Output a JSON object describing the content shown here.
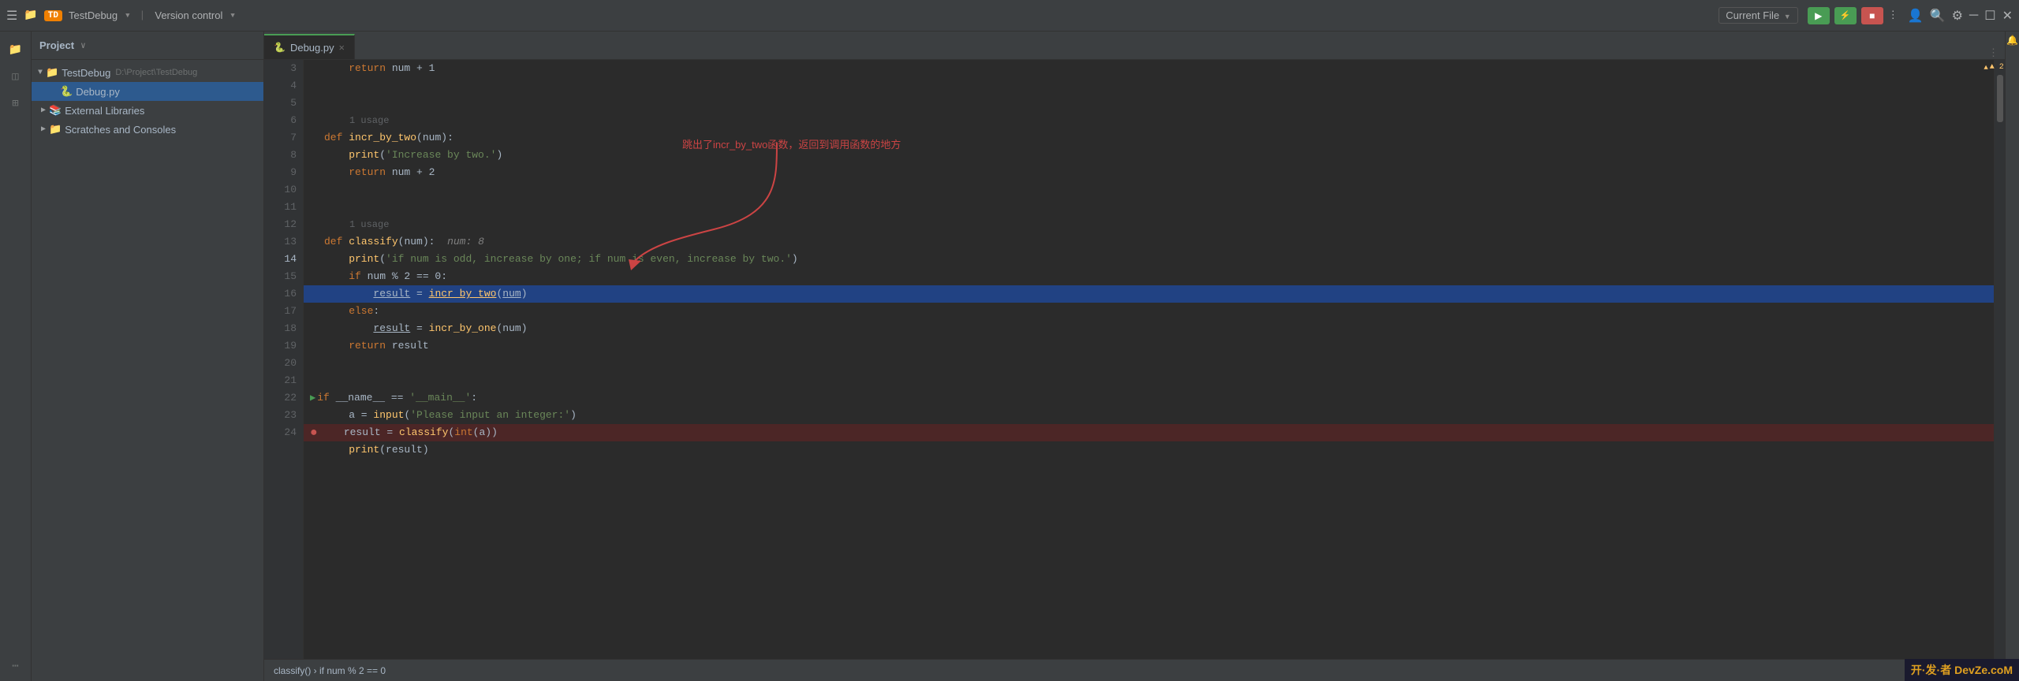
{
  "titlebar": {
    "td_badge": "TD",
    "project_name": "TestDebug",
    "project_path_indicator": "▼",
    "version_control": "Version control",
    "version_control_indicator": "▼",
    "current_file": "Current File",
    "current_file_indicator": "▼",
    "run_label": "▶",
    "debug_label": "▶",
    "stop_label": "■"
  },
  "project_panel": {
    "title": "Project",
    "title_indicator": "∨",
    "tree": [
      {
        "id": "testdebug-root",
        "label": "TestDebug",
        "path": "D:\\Project\\TestDebug",
        "level": 0,
        "type": "folder",
        "expanded": true,
        "arrow": "▼"
      },
      {
        "id": "debug-py",
        "label": "Debug.py",
        "level": 1,
        "type": "python-file",
        "selected": true
      },
      {
        "id": "external-libs",
        "label": "External Libraries",
        "level": 1,
        "type": "library-folder",
        "expanded": false,
        "arrow": "▶"
      },
      {
        "id": "scratches",
        "label": "Scratches and Consoles",
        "level": 1,
        "type": "folder",
        "expanded": false,
        "arrow": "▶"
      }
    ]
  },
  "editor": {
    "tab_label": "Debug.py",
    "lines": [
      {
        "num": 3,
        "content": "    return num + 1",
        "tokens": [
          {
            "t": "    "
          },
          {
            "t": "return",
            "c": "kw"
          },
          {
            "t": " num + 1",
            "c": "param"
          }
        ]
      },
      {
        "num": 4,
        "content": "",
        "tokens": []
      },
      {
        "num": 5,
        "content": "",
        "tokens": []
      },
      {
        "num": 6,
        "content": "def incr_by_two(num):",
        "tokens": [
          {
            "t": "def ",
            "c": "kw"
          },
          {
            "t": "incr_by_two",
            "c": "fn"
          },
          {
            "t": "(",
            "c": "paren"
          },
          {
            "t": "num",
            "c": "param"
          },
          {
            "t": "):",
            "c": "paren"
          }
        ],
        "usage": "1 usage"
      },
      {
        "num": 7,
        "content": "    print('Increase by two.')",
        "tokens": [
          {
            "t": "    "
          },
          {
            "t": "print",
            "c": "fn"
          },
          {
            "t": "(",
            "c": "paren"
          },
          {
            "t": "'Increase by two.'",
            "c": "str"
          },
          {
            "t": ")",
            "c": "paren"
          }
        ]
      },
      {
        "num": 8,
        "content": "    return num + 2",
        "tokens": [
          {
            "t": "    "
          },
          {
            "t": "return",
            "c": "kw"
          },
          {
            "t": " num + 2",
            "c": "param"
          }
        ]
      },
      {
        "num": 9,
        "content": "",
        "tokens": []
      },
      {
        "num": 10,
        "content": "",
        "tokens": []
      },
      {
        "num": 11,
        "content": "def classify(num):  num: 8",
        "tokens": [
          {
            "t": "def ",
            "c": "kw"
          },
          {
            "t": "classify",
            "c": "fn"
          },
          {
            "t": "(",
            "c": "paren"
          },
          {
            "t": "num",
            "c": "param"
          },
          {
            "t": "):",
            "c": "paren"
          },
          {
            "t": "  num: 8",
            "c": "debug-var"
          }
        ],
        "usage": "1 usage"
      },
      {
        "num": 12,
        "content": "    print('if num is odd, increase by one; if num is even, increase by two.')",
        "tokens": [
          {
            "t": "    "
          },
          {
            "t": "print",
            "c": "fn"
          },
          {
            "t": "(",
            "c": "paren"
          },
          {
            "t": "'if num is odd, increase by one; if num is even, increase by two.'",
            "c": "str"
          },
          {
            "t": ")",
            "c": "paren"
          }
        ]
      },
      {
        "num": 13,
        "content": "    if num % 2 == 0:",
        "tokens": [
          {
            "t": "    "
          },
          {
            "t": "if",
            "c": "kw"
          },
          {
            "t": " num % 2 == 0:",
            "c": "param"
          }
        ]
      },
      {
        "num": 14,
        "content": "        result = incr_by_two(num)",
        "tokens": [
          {
            "t": "        "
          },
          {
            "t": "result",
            "c": "var-name"
          },
          {
            "t": " = ",
            "c": "op"
          },
          {
            "t": "incr_by_two",
            "c": "fn"
          },
          {
            "t": "(",
            "c": "paren"
          },
          {
            "t": "num",
            "c": "param"
          },
          {
            "t": ")",
            "c": "paren"
          }
        ],
        "highlighted": true
      },
      {
        "num": 15,
        "content": "    else:",
        "tokens": [
          {
            "t": "    "
          },
          {
            "t": "else",
            "c": "kw"
          },
          {
            "t": ":"
          }
        ]
      },
      {
        "num": 16,
        "content": "        result = incr_by_one(num)",
        "tokens": [
          {
            "t": "        "
          },
          {
            "t": "result",
            "c": "var-name"
          },
          {
            "t": " = ",
            "c": "op"
          },
          {
            "t": "incr_by_one",
            "c": "fn"
          },
          {
            "t": "(",
            "c": "paren"
          },
          {
            "t": "num",
            "c": "param"
          },
          {
            "t": ")",
            "c": "paren"
          }
        ]
      },
      {
        "num": 17,
        "content": "    return result",
        "tokens": [
          {
            "t": "    "
          },
          {
            "t": "return",
            "c": "kw"
          },
          {
            "t": " result",
            "c": "param"
          }
        ]
      },
      {
        "num": 18,
        "content": "",
        "tokens": []
      },
      {
        "num": 19,
        "content": "",
        "tokens": []
      },
      {
        "num": 20,
        "content": "if __name__ == '__main__':",
        "tokens": [
          {
            "t": "if",
            "c": "kw"
          },
          {
            "t": " __name__ == ",
            "c": "param"
          },
          {
            "t": "'__main__'",
            "c": "str"
          },
          {
            "t": ":"
          }
        ],
        "hasRunMarker": true
      },
      {
        "num": 21,
        "content": "    a = input('Please input an integer:')",
        "tokens": [
          {
            "t": "    "
          },
          {
            "t": "a",
            "c": "var-name"
          },
          {
            "t": " = "
          },
          {
            "t": "input",
            "c": "fn"
          },
          {
            "t": "(",
            "c": "paren"
          },
          {
            "t": "'Please input an integer:'",
            "c": "str"
          },
          {
            "t": ")",
            "c": "paren"
          }
        ]
      },
      {
        "num": 22,
        "content": "    result = classify(int(a))",
        "tokens": [
          {
            "t": "    "
          },
          {
            "t": "result",
            "c": "var-name"
          },
          {
            "t": " = "
          },
          {
            "t": "classify",
            "c": "fn"
          },
          {
            "t": "(",
            "c": "paren"
          },
          {
            "t": "int",
            "c": "builtin"
          },
          {
            "t": "("
          },
          {
            "t": "a",
            "c": "var-name"
          },
          {
            "t": "))",
            "c": "paren"
          }
        ],
        "hasBreakpoint": true,
        "errorLine": true
      },
      {
        "num": 23,
        "content": "    print(result)",
        "tokens": [
          {
            "t": "    "
          },
          {
            "t": "print",
            "c": "fn"
          },
          {
            "t": "(",
            "c": "paren"
          },
          {
            "t": "result",
            "c": "var-name"
          },
          {
            "t": ")",
            "c": "paren"
          }
        ]
      },
      {
        "num": 24,
        "content": "",
        "tokens": []
      }
    ]
  },
  "annotation": {
    "text": "跳出了incr_by_two函数，返回到调用函数的地方"
  },
  "status_bar": {
    "breadcrumb": "classify()  ›  if num % 2 == 0"
  },
  "right_gutter": {
    "warning_count": "▲ 2",
    "up_arrow": "^",
    "down_arrow": "v"
  },
  "watermark": {
    "text": "开·发·者 DevZe.coM"
  },
  "sidebar": {
    "icons": [
      "☰",
      "◫",
      "⊞",
      "⋯"
    ]
  }
}
